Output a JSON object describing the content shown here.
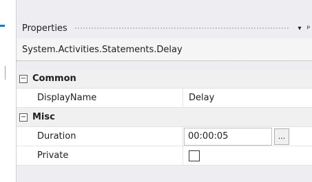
{
  "panel": {
    "title": "Properties",
    "dropdown_icon": "▾",
    "pin_icon": "ᵖ",
    "object_line": "System.Activities.Statements.Delay"
  },
  "categories": [
    {
      "toggle": "⊟",
      "label": "Common",
      "rows": [
        {
          "name": "DisplayName",
          "value": "Delay"
        }
      ]
    },
    {
      "toggle": "⊟",
      "label": "Misc",
      "rows": [
        {
          "name": "Duration",
          "value": "00:00:05",
          "button": "..."
        },
        {
          "name": "Private",
          "value": ""
        }
      ]
    }
  ],
  "colors": {
    "panel_bg": "#eeeef2",
    "accent": "#007acc"
  }
}
